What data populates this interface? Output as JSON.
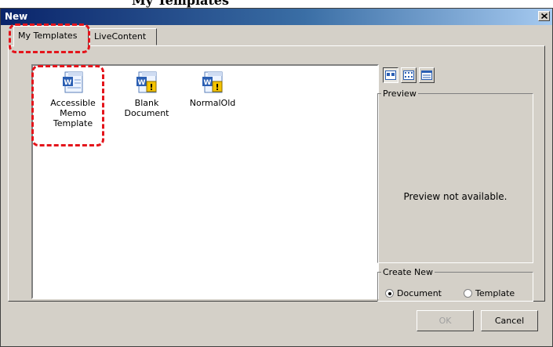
{
  "caption": "My Templates",
  "window": {
    "title": "New",
    "close_glyph": "✕"
  },
  "tabs": [
    {
      "label": "My Templates",
      "active": true
    },
    {
      "label": "LiveContent",
      "active": false
    }
  ],
  "templates": [
    {
      "label_lines": [
        "Accessible",
        "Memo",
        "Template"
      ],
      "icon": "word-template-icon"
    },
    {
      "label_lines": [
        "Blank",
        "Document"
      ],
      "icon": "word-template-warning-icon"
    },
    {
      "label_lines": [
        "NormalOld"
      ],
      "icon": "word-template-warning-icon"
    }
  ],
  "view_buttons": [
    {
      "name": "large-icons-view-button",
      "icon": "large-icons-icon",
      "pressed": true
    },
    {
      "name": "list-view-button",
      "icon": "list-view-icon",
      "pressed": false
    },
    {
      "name": "details-view-button",
      "icon": "details-view-icon",
      "pressed": false
    }
  ],
  "preview": {
    "label": "Preview",
    "message": "Preview not available."
  },
  "create_new": {
    "label": "Create New",
    "options": [
      {
        "label": "Document",
        "checked": true
      },
      {
        "label": "Template",
        "checked": false
      }
    ]
  },
  "buttons": {
    "ok": "OK",
    "cancel": "Cancel",
    "ok_disabled": true
  },
  "colors": {
    "highlight": "#e4141b",
    "dialog_bg": "#d4d0c8",
    "titlebar": "#0a246a"
  }
}
